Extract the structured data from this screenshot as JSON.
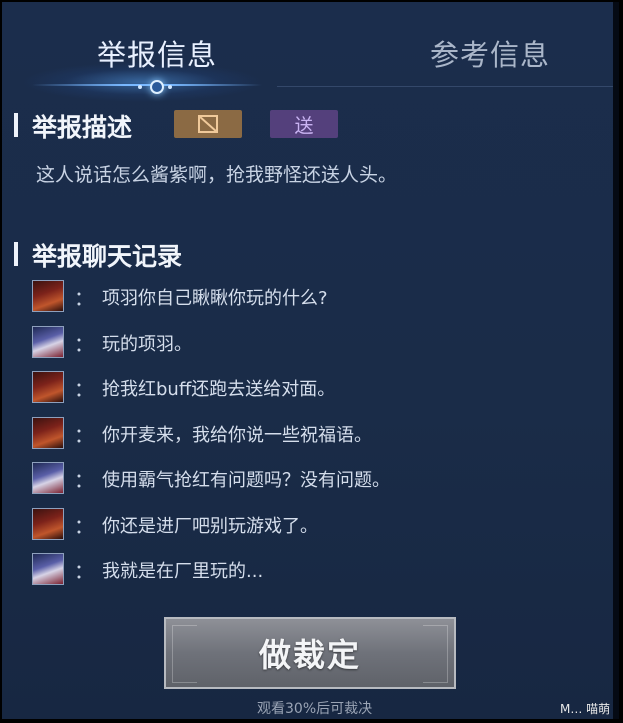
{
  "tabs": {
    "active": "举报信息",
    "inactive": "参考信息"
  },
  "report_description": {
    "title": "举报描述",
    "tags": [
      {
        "label": "",
        "icon": "no-sign-icon",
        "color": "#8b6a44"
      },
      {
        "label": "送",
        "color": "#54407c"
      }
    ],
    "text": "这人说话怎么酱紫啊，抢我野怪还送人头。"
  },
  "chat_log": {
    "title": "举报聊天记录",
    "separator": "：",
    "messages": [
      {
        "speaker": "a",
        "text": "项羽你自己瞅瞅你玩的什么?"
      },
      {
        "speaker": "b",
        "text": "玩的项羽。"
      },
      {
        "speaker": "a",
        "text": "抢我红buff还跑去送给对面。"
      },
      {
        "speaker": "a",
        "text": "你开麦来，我给你说一些祝福语。"
      },
      {
        "speaker": "b",
        "text": "使用霸气抢红有问题吗？没有问题。"
      },
      {
        "speaker": "a",
        "text": "你还是进厂吧别玩游戏了。"
      },
      {
        "speaker": "b",
        "text": "我就是在厂里玩的..."
      }
    ]
  },
  "verdict": {
    "button": "做裁定",
    "hint": "观看30%后可裁决"
  },
  "watermark": "M… 喵萌"
}
